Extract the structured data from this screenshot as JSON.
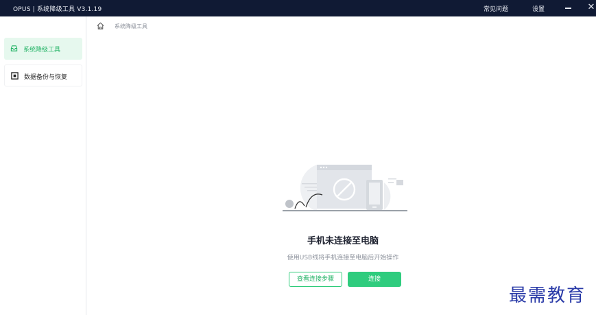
{
  "titlebar": {
    "app_title": "OPUS | 系统降级工具  V3.1.19",
    "faq_label": "常见问题",
    "settings_label": "设置",
    "close_glyph": "✕"
  },
  "sidebar": {
    "items": [
      {
        "label": "系统降级工具",
        "icon": "inbox-icon",
        "active": true
      },
      {
        "label": "数据备份与恢复",
        "icon": "backup-square-icon",
        "active": false
      }
    ]
  },
  "breadcrumb": {
    "current": "系统降级工具"
  },
  "empty_state": {
    "title": "手机未连接至电脑",
    "description": "使用USB线将手机连接至电脑后开始操作",
    "steps_button": "查看连接步骤",
    "connect_button": "连接"
  },
  "watermark": {
    "text": "最需教育"
  },
  "colors": {
    "titlebar_bg": "#101a34",
    "accent_green": "#2fcc7e",
    "active_bg": "#e6f8ee"
  }
}
